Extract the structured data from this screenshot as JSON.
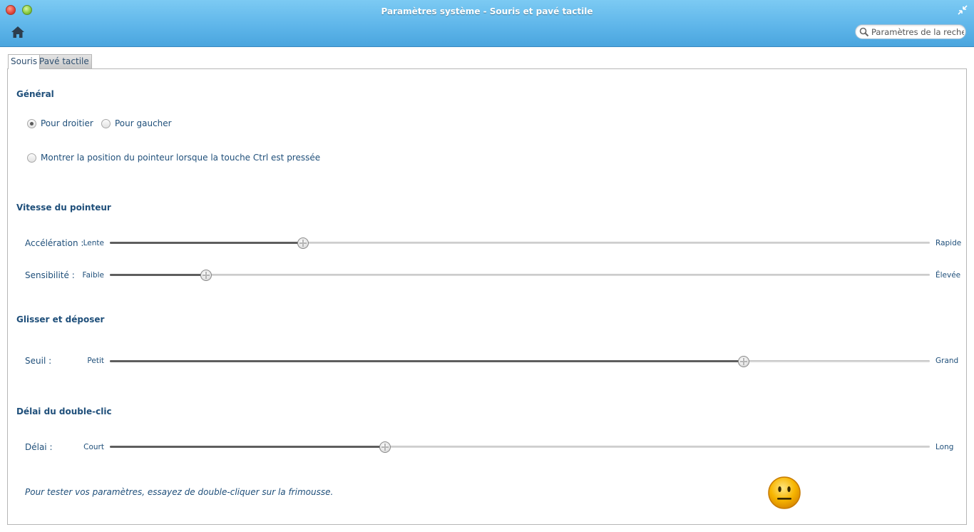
{
  "window": {
    "title": "Paramètres système - Souris et pavé tactile"
  },
  "toolbar": {
    "search_placeholder": "Paramètres de la recher"
  },
  "tabs": [
    {
      "label": "Souris",
      "active": true
    },
    {
      "label": "Pavé tactile",
      "active": false
    }
  ],
  "general": {
    "title": "Général",
    "right_handed": "Pour droitier",
    "left_handed": "Pour gaucher",
    "selected": "right_handed",
    "show_pointer": "Montrer la position du pointeur lorsque la touche Ctrl est pressée",
    "show_pointer_checked": false
  },
  "pointer_speed": {
    "title": "Vitesse du pointeur",
    "acceleration": {
      "label": "Accélération :",
      "min": "Lente",
      "max": "Rapide",
      "value": 0.236
    },
    "sensitivity": {
      "label": "Sensibilité :",
      "min": "Faible",
      "max": "Élevée",
      "value": 0.117
    }
  },
  "drag_drop": {
    "title": "Glisser et déposer",
    "threshold": {
      "label": "Seuil :",
      "min": "Petit",
      "max": "Grand",
      "value": 0.773
    }
  },
  "double_click": {
    "title": "Délai du double-clic",
    "delay": {
      "label": "Délai :",
      "min": "Court",
      "max": "Long",
      "value": 0.336
    },
    "test_text": "Pour tester vos paramètres, essayez de double-cliquer sur la frimousse."
  },
  "colors": {
    "titlebar": "#5fb6ea",
    "text": "#1f4f7a",
    "smiley": "#f5b400"
  }
}
